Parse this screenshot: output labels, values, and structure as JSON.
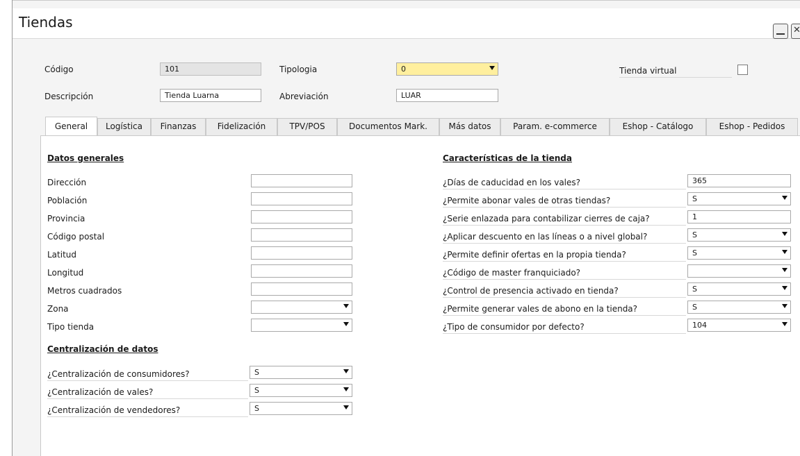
{
  "window": {
    "title": "Tiendas"
  },
  "header": {
    "codigo_label": "Código",
    "codigo_value": "101",
    "tipologia_label": "Tipologia",
    "tipologia_value": "0",
    "tienda_virtual_label": "Tienda virtual",
    "descripcion_label": "Descripción",
    "descripcion_value": "Tienda Luarna",
    "abreviacion_label": "Abreviación",
    "abreviacion_value": "LUAR"
  },
  "tabs": [
    "General",
    "Logística",
    "Finanzas",
    "Fidelización",
    "TPV/POS",
    "Documentos Mark.",
    "Más datos",
    "Param. e-commerce",
    "Eshop - Catálogo",
    "Eshop - Pedidos"
  ],
  "datos_generales": {
    "title": "Datos generales",
    "fields": [
      {
        "label": "Dirección",
        "value": ""
      },
      {
        "label": "Población",
        "value": ""
      },
      {
        "label": "Provincia",
        "value": ""
      },
      {
        "label": "Código postal",
        "value": ""
      },
      {
        "label": "Latitud",
        "value": ""
      },
      {
        "label": "Longitud",
        "value": ""
      },
      {
        "label": "Metros cuadrados",
        "value": ""
      },
      {
        "label": "Zona",
        "value": ""
      },
      {
        "label": "Tipo tienda",
        "value": ""
      }
    ]
  },
  "centralizacion": {
    "title": "Centralización de datos",
    "fields": [
      {
        "label": "¿Centralización de consumidores?",
        "value": "S"
      },
      {
        "label": "¿Centralización de vales?",
        "value": "S"
      },
      {
        "label": "¿Centralización de vendedores?",
        "value": "S"
      }
    ]
  },
  "caracteristicas": {
    "title": "Características de la tienda",
    "fields": [
      {
        "label": "¿Días de caducidad en los vales?",
        "value": "365"
      },
      {
        "label": "¿Permite abonar vales de otras tiendas?",
        "value": "S"
      },
      {
        "label": "¿Serie enlazada para contabilizar cierres de caja?",
        "value": "1"
      },
      {
        "label": "¿Aplicar descuento en las líneas o a nivel global?",
        "value": "S"
      },
      {
        "label": "¿Permite definir ofertas en la propia tienda?",
        "value": "S"
      },
      {
        "label": "¿Código de master franquiciado?",
        "value": ""
      },
      {
        "label": "¿Control de presencia activado en tienda?",
        "value": "S"
      },
      {
        "label": "¿Permite generar vales de abono en la tienda?",
        "value": "S"
      },
      {
        "label": "¿Tipo de consumidor por defecto?",
        "value": "104"
      }
    ]
  }
}
